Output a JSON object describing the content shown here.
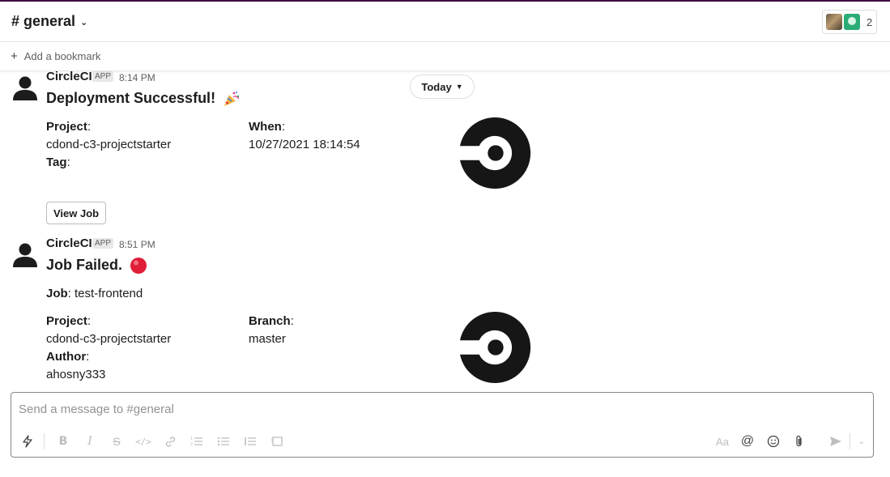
{
  "header": {
    "channel_title": "# general",
    "member_count": "2"
  },
  "bookmarks": {
    "add_label": "Add a bookmark"
  },
  "date_divider": {
    "label": "Today"
  },
  "messages": [
    {
      "sender": "CircleCI",
      "badge": "APP",
      "time": "8:14 PM",
      "title": "Deployment Successful!",
      "title_emoji": "party-popper",
      "fields": [
        {
          "label": "Project",
          "value": "cdond-c3-projectstarter"
        },
        {
          "label": "When",
          "value": "10/27/2021 18:14:54"
        },
        {
          "label": "Tag",
          "value": ""
        }
      ],
      "button_label": "View Job"
    },
    {
      "sender": "CircleCI",
      "badge": "APP",
      "time": "8:51 PM",
      "title": "Job Failed.",
      "title_emoji": "red-circle",
      "job_label": "Job",
      "job_value": "test-frontend",
      "fields": [
        {
          "label": "Project",
          "value": "cdond-c3-projectstarter"
        },
        {
          "label": "Branch",
          "value": "master"
        },
        {
          "label": "Author",
          "value": "ahosny333"
        }
      ]
    }
  ],
  "composer": {
    "placeholder": "Send a message to #general"
  },
  "toolbar_icons": [
    "shortcuts-icon",
    "bold-icon",
    "italic-icon",
    "strikethrough-icon",
    "code-icon",
    "link-icon",
    "ordered-list-icon",
    "bullet-list-icon",
    "blockquote-icon",
    "code-block-icon",
    "formatting-icon",
    "mention-icon",
    "emoji-icon",
    "attach-icon",
    "send-icon",
    "send-options-icon"
  ],
  "colors": {
    "accent": "#3f0e40",
    "failed": "#e01e37",
    "logo": "#161616"
  }
}
